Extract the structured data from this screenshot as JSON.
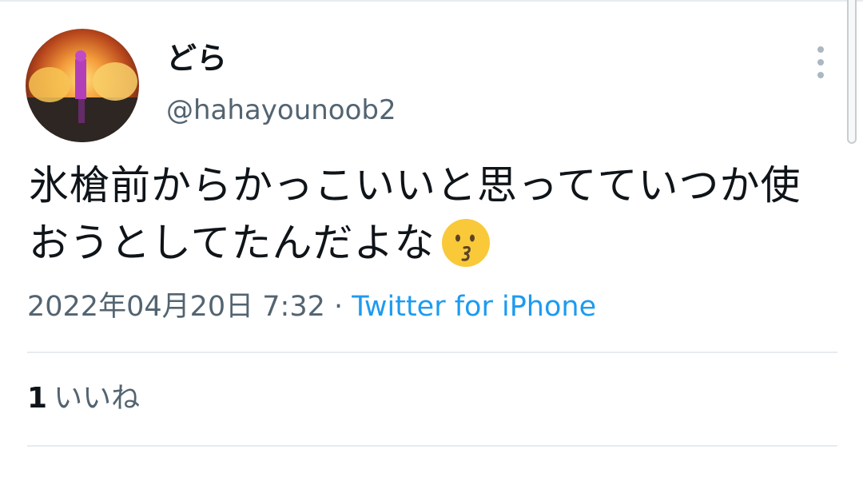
{
  "tweet": {
    "display_name": "どら",
    "handle": "@hahayounoob2",
    "text_line1": "氷槍前からかっこいいと思ってていつか使おうとしてたんだよな",
    "emoji": "kissing-face",
    "date": "2022年04月20日 7:32",
    "separator": "·",
    "source": "Twitter for iPhone",
    "likes_count": "1",
    "likes_label": "いいね"
  },
  "colors": {
    "text": "#0f1419",
    "secondary": "#536471",
    "link": "#1d9bf0",
    "divider": "#e6ecf0"
  }
}
